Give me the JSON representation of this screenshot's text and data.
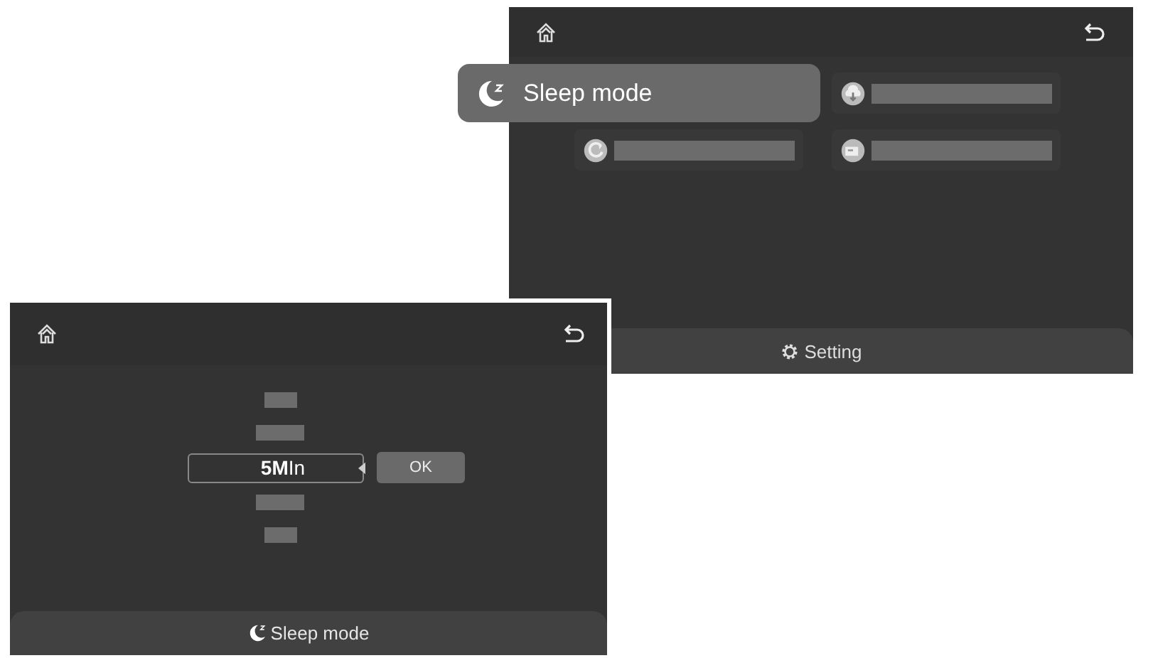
{
  "screens": [
    {
      "kind": "menu",
      "items": [
        {
          "label": "Sleep mode",
          "selected": true
        },
        {
          "selected": false
        },
        {
          "selected": false
        },
        {
          "selected": false
        }
      ],
      "bottom_bar": {
        "label": "Setting"
      }
    },
    {
      "kind": "picker",
      "value": "**5M**In",
      "button": "OK",
      "bottom_bar": {
        "label": "Sleep mode"
      }
    }
  ]
}
